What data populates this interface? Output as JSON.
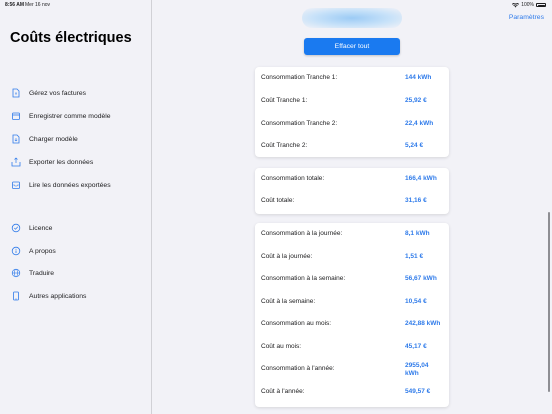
{
  "status_bar": {
    "time": "8:56 AM",
    "date": "Mer 16 nov",
    "battery": "100%"
  },
  "sidebar": {
    "title": "Coûts électriques",
    "menu": [
      {
        "label": "Gérez vos factures",
        "icon": "document-euro-icon"
      },
      {
        "label": "Enregistrer comme modèle",
        "icon": "tray-icon"
      },
      {
        "label": "Charger modèle",
        "icon": "document-load-icon"
      },
      {
        "label": "Exporter les données",
        "icon": "export-tray-icon"
      },
      {
        "label": "Lire les données exportées",
        "icon": "import-tray-icon"
      }
    ],
    "menu2": [
      {
        "label": "Licence",
        "icon": "checkmark-circle-icon"
      },
      {
        "label": "A propos",
        "icon": "info-circle-icon"
      },
      {
        "label": "Traduire",
        "icon": "globe-icon"
      },
      {
        "label": "Autres applications",
        "icon": "tablet-icon"
      }
    ]
  },
  "header": {
    "settings_label": "Paramètres"
  },
  "main": {
    "clear_button": "Effacer tout",
    "card1": [
      {
        "label": "Consommation Tranche 1:",
        "value": "144 kWh"
      },
      {
        "label": "Coût Tranche 1:",
        "value": "25,92 €"
      },
      {
        "label": "Consommation Tranche 2:",
        "value": "22,4 kWh"
      },
      {
        "label": "Coût Tranche 2:",
        "value": "5,24 €"
      }
    ],
    "card2": [
      {
        "label": "Consommation totale:",
        "value": "166,4 kWh"
      },
      {
        "label": "Coût totale:",
        "value": "31,16 €"
      }
    ],
    "card3": [
      {
        "label": "Consommation à la journée:",
        "value": "8,1 kWh"
      },
      {
        "label": "Coût à la journée:",
        "value": "1,51 €"
      },
      {
        "label": "Consommation à la semaine:",
        "value": "56,67 kWh"
      },
      {
        "label": "Coût à la semaine:",
        "value": "10,54 €"
      },
      {
        "label": "Consommation au mois:",
        "value": "242,88 kWh"
      },
      {
        "label": "Coût au mois:",
        "value": "45,17 €"
      },
      {
        "label": "Consommation à l'année:",
        "value": "2955,04 kWh"
      },
      {
        "label": "Coût à l'année:",
        "value": "549,57 €"
      }
    ]
  },
  "colors": {
    "accent": "#1a7af0",
    "value_text": "#2f7bea",
    "background": "#f2f2f7"
  }
}
